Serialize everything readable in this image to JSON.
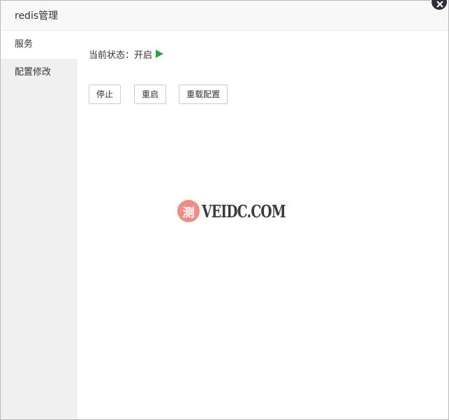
{
  "dialog": {
    "title": "redis管理"
  },
  "sidebar": {
    "items": [
      {
        "label": "服务"
      },
      {
        "label": "配置修改"
      }
    ]
  },
  "service": {
    "status_label": "当前状态：",
    "status_value": "开启",
    "buttons": {
      "stop": "停止",
      "restart": "重启",
      "reload": "重载配置"
    }
  },
  "watermark": {
    "badge": "测",
    "text": "VEIDC.COM"
  },
  "colors": {
    "status_play": "#2fa33a",
    "close_button": "#2e2d3c",
    "sidebar_bg": "#f0f0f0",
    "titlebar_bg": "#f8f8f8",
    "watermark_badge": "#f28b86"
  },
  "icons": {
    "close": "close-icon",
    "status": "play-icon"
  }
}
